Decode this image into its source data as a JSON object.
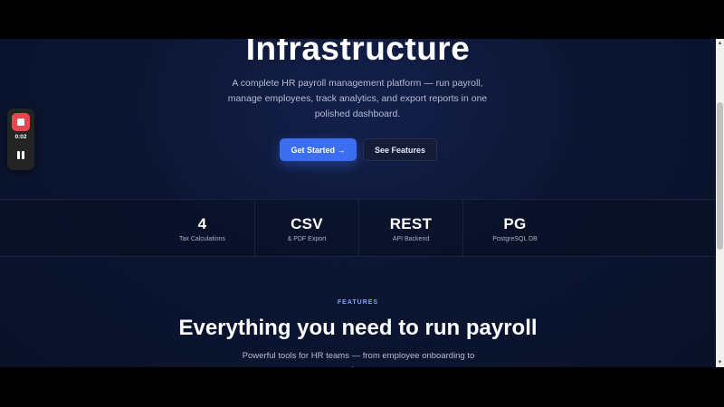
{
  "hero": {
    "title": "Infrastructure",
    "subtitle": "A complete HR payroll management platform — run payroll, manage employees, track analytics, and export reports in one polished dashboard.",
    "primary_button": "Get Started →",
    "secondary_button": "See Features"
  },
  "stats": [
    {
      "value": "4",
      "label": "Tax Calculations"
    },
    {
      "value": "CSV",
      "label": "& PDF Export"
    },
    {
      "value": "REST",
      "label": "API Backend"
    },
    {
      "value": "PG",
      "label": "PostgreSQL DB"
    }
  ],
  "features": {
    "eyebrow": "FEATURES",
    "title": "Everything you need to run payroll",
    "subtitle": "Powerful tools for HR teams — from employee onboarding to tax-"
  },
  "recorder": {
    "elapsed": "0:02",
    "stop_icon": "stop-record-icon",
    "pause_icon": "pause-icon"
  },
  "colors": {
    "accent": "#3b6ff0",
    "background": "#0c1633",
    "recording_red": "#e5484d"
  }
}
